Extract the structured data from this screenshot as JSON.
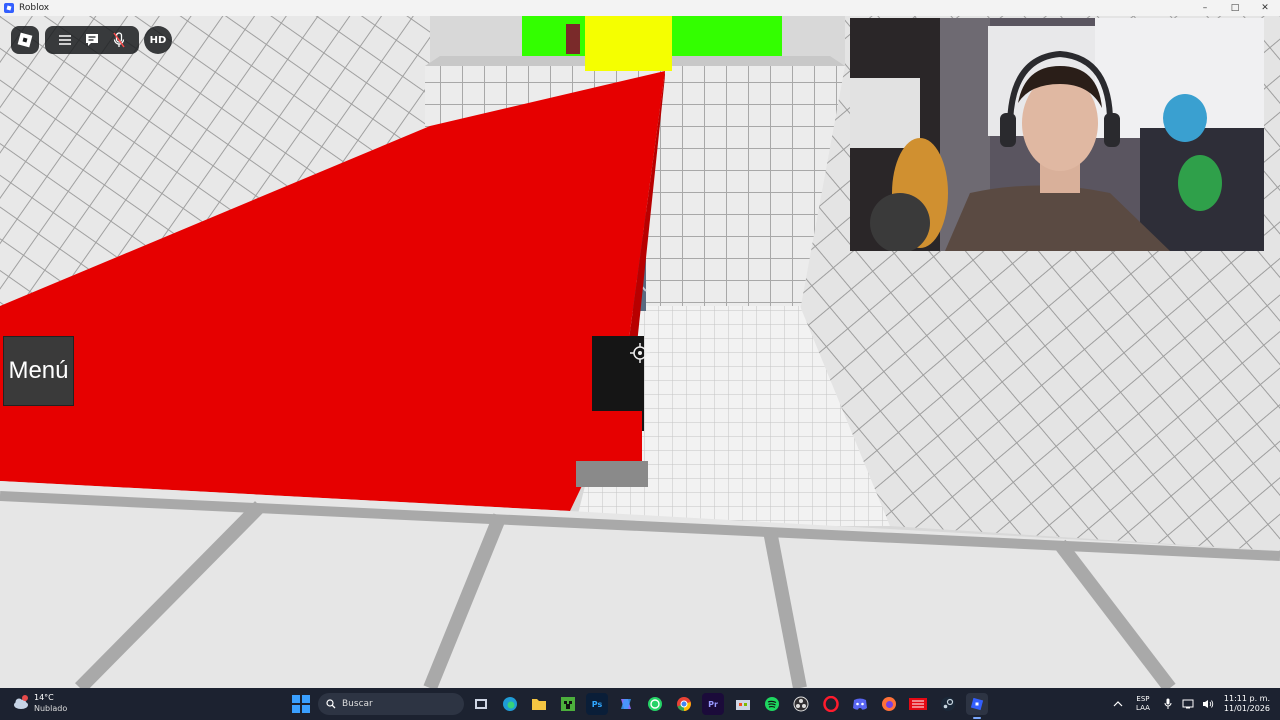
{
  "window": {
    "title": "Roblox",
    "controls": [
      "minimize",
      "maximize",
      "close"
    ]
  },
  "hud": {
    "hd_label": "HD",
    "menu_label": "Menú",
    "icons": [
      "roblox-logo-icon",
      "hamburger-menu-icon",
      "chat-icon",
      "microphone-muted-icon"
    ]
  },
  "colors": {
    "red_platform": "#e60000",
    "yellow_block": "#f5ff00",
    "green_block": "#33ff00",
    "floor": "#e6e6e6",
    "taskbar": "#1c2230"
  },
  "taskbar": {
    "weather": {
      "temp": "14°C",
      "condition": "Nublado"
    },
    "search_placeholder": "Buscar",
    "apps": [
      {
        "name": "task-view",
        "label": ""
      },
      {
        "name": "edge",
        "label": ""
      },
      {
        "name": "file-explorer",
        "label": ""
      },
      {
        "name": "minecraft",
        "label": ""
      },
      {
        "name": "photoshop",
        "label": "Ps"
      },
      {
        "name": "copilot",
        "label": ""
      },
      {
        "name": "whatsapp",
        "label": ""
      },
      {
        "name": "chrome",
        "label": ""
      },
      {
        "name": "premiere",
        "label": "Pr"
      },
      {
        "name": "store",
        "label": ""
      },
      {
        "name": "spotify",
        "label": ""
      },
      {
        "name": "obs",
        "label": ""
      },
      {
        "name": "opera",
        "label": ""
      },
      {
        "name": "discord",
        "label": ""
      },
      {
        "name": "firefox",
        "label": ""
      },
      {
        "name": "netflix",
        "label": ""
      },
      {
        "name": "steam",
        "label": ""
      },
      {
        "name": "roblox",
        "label": ""
      }
    ],
    "tray": {
      "lang_line1": "ESP",
      "lang_line2": "LAA",
      "time": "11:11 p. m.",
      "date": "11/01/2026"
    }
  }
}
